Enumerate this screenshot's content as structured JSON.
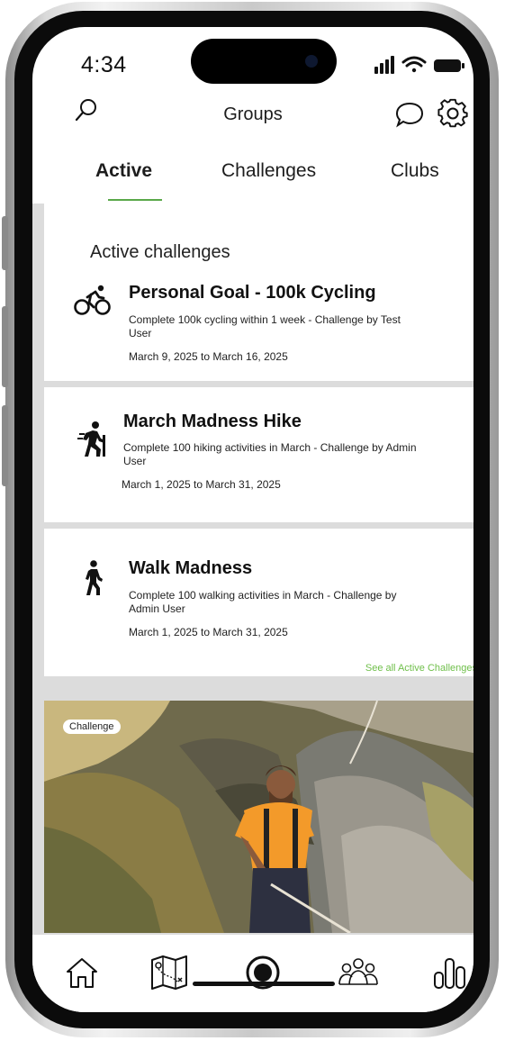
{
  "status_bar": {
    "time": "4:34"
  },
  "header": {
    "title": "Groups",
    "search_icon": "search-icon",
    "chat_icon": "chat-bubble-icon",
    "settings_icon": "gear-icon"
  },
  "tabs": [
    {
      "label": "Active",
      "active": true
    },
    {
      "label": "Challenges",
      "active": false
    },
    {
      "label": "Clubs",
      "active": false
    }
  ],
  "active_challenges": {
    "section_title": "Active challenges",
    "items": [
      {
        "icon": "cycling-icon",
        "title": "Personal Goal - 100k Cycling",
        "description": "Complete 100k cycling within 1 week - Challenge by Test User",
        "dates": "March 9, 2025 to March 16, 2025"
      },
      {
        "icon": "hiking-icon",
        "title": "March Madness Hike",
        "description": "Complete 100 hiking activities in March - Challenge by Admin User",
        "dates": "March 1, 2025 to March 31, 2025"
      },
      {
        "icon": "walking-icon",
        "title": "Walk Madness",
        "description": "Complete 100 walking activities in March - Challenge by Admin User",
        "dates": "March 1, 2025 to March 31, 2025"
      }
    ],
    "see_all_label": "See all Active Challenges"
  },
  "featured": {
    "badge": "Challenge"
  },
  "bottom_nav": [
    {
      "icon": "home-icon"
    },
    {
      "icon": "map-icon"
    },
    {
      "icon": "record-icon"
    },
    {
      "icon": "groups-icon"
    },
    {
      "icon": "stats-icon"
    }
  ],
  "colors": {
    "accent": "#5aa84a",
    "link": "#6fbf4a",
    "background": "#dcdcdc"
  }
}
